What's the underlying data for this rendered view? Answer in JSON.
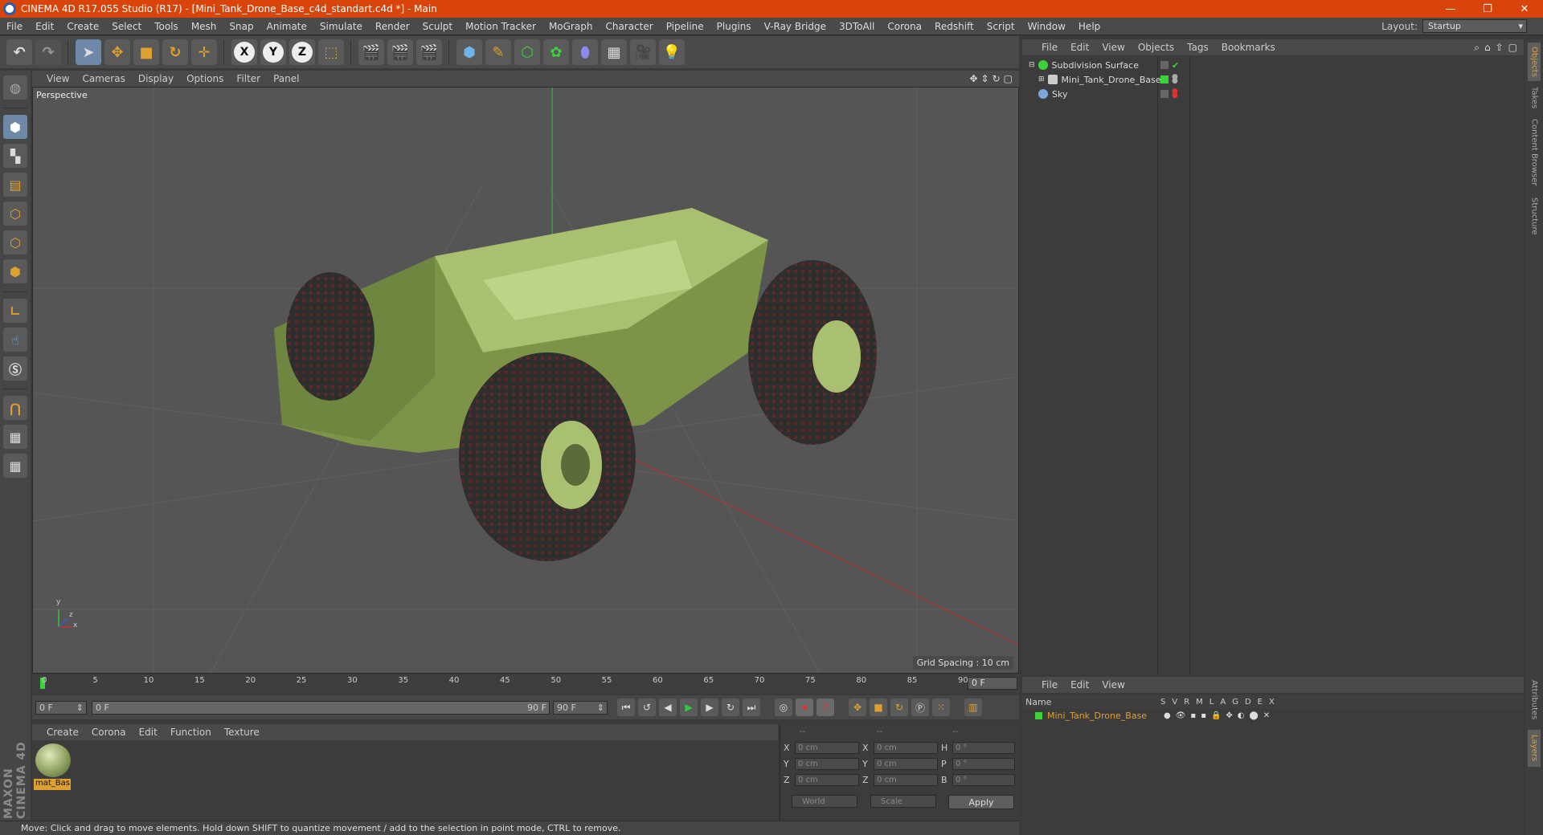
{
  "window": {
    "title": "CINEMA 4D R17.055 Studio (R17) - [Mini_Tank_Drone_Base_c4d_standart.c4d *] - Main",
    "minimize": "—",
    "maximize": "❐",
    "close": "✕"
  },
  "menubar": {
    "items": [
      "File",
      "Edit",
      "Create",
      "Select",
      "Tools",
      "Mesh",
      "Snap",
      "Animate",
      "Simulate",
      "Render",
      "Sculpt",
      "Motion Tracker",
      "MoGraph",
      "Character",
      "Pipeline",
      "Plugins",
      "V-Ray Bridge",
      "3DToAll",
      "Corona",
      "Redshift",
      "Script",
      "Window",
      "Help"
    ],
    "layout_label": "Layout:",
    "layout_value": "Startup"
  },
  "toolbar": {
    "icons": [
      "undo-icon",
      "redo-icon",
      "select-arrow-icon",
      "move-icon",
      "scale-icon",
      "rotate-icon",
      "transform-icon",
      "x-axis-icon",
      "y-axis-icon",
      "z-axis-icon",
      "coordinate-system-icon",
      "render-view-icon",
      "render-picture-viewer-icon",
      "edit-render-settings-icon",
      "cube-icon",
      "pen-icon",
      "subdivision-icon",
      "cloner-icon",
      "deformer-icon",
      "floor-icon",
      "camera-icon",
      "light-icon"
    ],
    "x_label": "X",
    "y_label": "Y",
    "z_label": "Z"
  },
  "viewport": {
    "menu": [
      "View",
      "Cameras",
      "Display",
      "Options",
      "Filter",
      "Panel"
    ],
    "label": "Perspective",
    "grid_spacing": "Grid Spacing : 10 cm",
    "axis_y": "y",
    "axis_z": "z",
    "axis_x": "x"
  },
  "timeline": {
    "ticks": [
      "0",
      "5",
      "10",
      "15",
      "20",
      "25",
      "30",
      "35",
      "40",
      "45",
      "50",
      "55",
      "60",
      "65",
      "70",
      "75",
      "80",
      "85",
      "90"
    ],
    "current_frame": "0 F",
    "start": "0 F",
    "slider_start": "0 F",
    "slider_end": "90 F",
    "end": "90 F"
  },
  "material_manager": {
    "menu": [
      "Create",
      "Corona",
      "Edit",
      "Function",
      "Texture"
    ],
    "material_name": "mat_Bas"
  },
  "coordinates": {
    "headers": [
      "--",
      "--",
      "--"
    ],
    "rows": [
      {
        "l1": "X",
        "v1": "0 cm",
        "l2": "X",
        "v2": "0 cm",
        "l3": "H",
        "v3": "0 °"
      },
      {
        "l1": "Y",
        "v1": "0 cm",
        "l2": "Y",
        "v2": "0 cm",
        "l3": "P",
        "v3": "0 °"
      },
      {
        "l1": "Z",
        "v1": "0 cm",
        "l2": "Z",
        "v2": "0 cm",
        "l3": "B",
        "v3": "0 °"
      }
    ],
    "mode1": "World",
    "mode2": "Scale",
    "apply": "Apply"
  },
  "status": {
    "text": "Move: Click and drag to move elements. Hold down SHIFT to quantize movement / add to the selection in point mode, CTRL to remove."
  },
  "object_manager": {
    "menu": [
      "File",
      "Edit",
      "View",
      "Objects",
      "Tags",
      "Bookmarks"
    ],
    "objects": [
      {
        "name": "Subdivision Surface",
        "indent": 0,
        "icon_color": "#3cd23c"
      },
      {
        "name": "Mini_Tank_Drone_Base",
        "indent": 1,
        "icon_color": "#cccccc"
      },
      {
        "name": "Sky",
        "indent": 0,
        "icon_color": "#7aa6d8"
      }
    ]
  },
  "layer_manager": {
    "menu": [
      "File",
      "Edit",
      "View"
    ],
    "name_header": "Name",
    "flags": [
      "S",
      "V",
      "R",
      "M",
      "L",
      "A",
      "G",
      "D",
      "E",
      "X"
    ],
    "layer_name": "Mini_Tank_Drone_Base",
    "layer_color": "#3cd23c"
  },
  "side_tabs": [
    "Objects",
    "Takes",
    "Content Browser",
    "Structure",
    "Attributes",
    "Layers"
  ],
  "brand": "MAXON CINEMA 4D"
}
